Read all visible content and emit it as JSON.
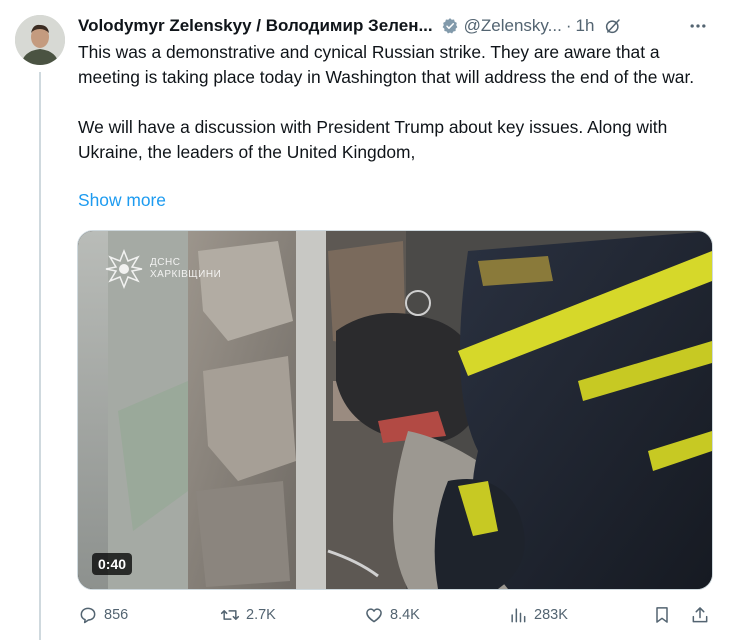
{
  "author": {
    "name": "Volodymyr Zelenskyy / Володимир Зелен...",
    "handle": "@Zelensky...",
    "time": "1h"
  },
  "post": {
    "paragraph_1": "This was a demonstrative and cynical Russian strike. They are aware that a meeting is taking place today in Washington that will address the end of the war.",
    "paragraph_2": "We will have a discussion with President Trump about key issues. Along with Ukraine, the leaders of the United Kingdom,",
    "show_more": "Show more"
  },
  "media": {
    "duration": "0:40",
    "watermark_line1": "ДСНС",
    "watermark_line2": "ХАРКІВЩИНИ"
  },
  "actions": {
    "replies": "856",
    "reposts": "2.7K",
    "likes": "8.4K",
    "views": "283K"
  },
  "icons": [
    "verified-badge-icon",
    "grok-icon",
    "more-icon",
    "reply-icon",
    "repost-icon",
    "like-icon",
    "views-icon",
    "bookmark-icon",
    "share-icon"
  ],
  "colors": {
    "link": "#1d9bf0",
    "secondary": "#536471",
    "verified": "#829aab"
  }
}
